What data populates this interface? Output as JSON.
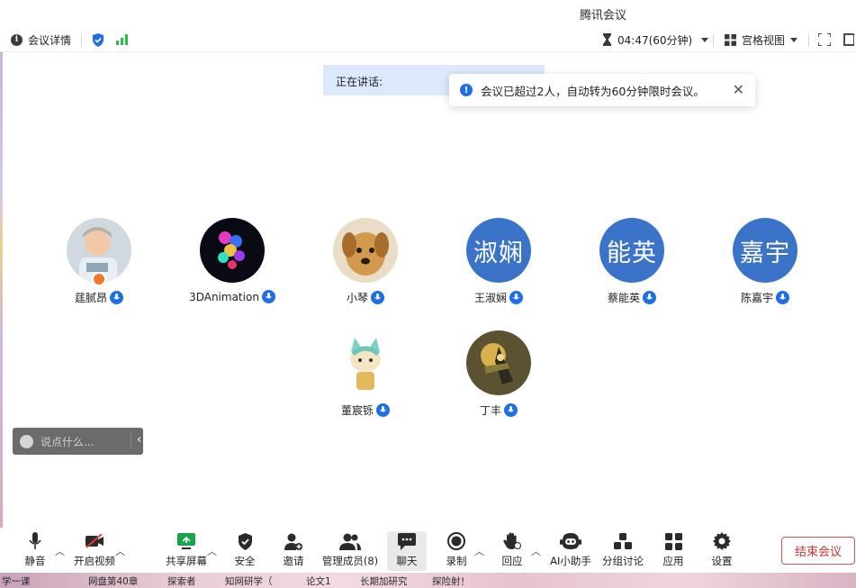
{
  "window": {
    "title": "腾讯会议"
  },
  "topbar": {
    "meeting_details": "会议详情",
    "timer": "04:47(60分钟)",
    "view_mode": "宫格视图"
  },
  "speaking": {
    "label": "正在讲话:"
  },
  "toast": {
    "message": "会议已超过2人，自动转为60分钟限时会议。"
  },
  "participants": [
    {
      "name": "莛腻昂",
      "avatar": "photo-baby"
    },
    {
      "name": "3DAnimation",
      "avatar": "photo-balloons"
    },
    {
      "name": "小琴",
      "avatar": "photo-dog"
    },
    {
      "name": "王淑娴",
      "avatar_text": "淑娴"
    },
    {
      "name": "蔡能英",
      "avatar_text": "能英"
    },
    {
      "name": "陈嘉宇",
      "avatar_text": "嘉宇"
    },
    {
      "name": "董宸铄",
      "avatar": "cartoon-cat"
    },
    {
      "name": "丁丰",
      "avatar": "photo-robot"
    }
  ],
  "chat": {
    "placeholder": "说点什么..."
  },
  "toolbar": {
    "mute": "静音",
    "video": "开启视频",
    "share": "共享屏幕",
    "security": "安全",
    "invite": "邀请",
    "members": "管理成员(8)",
    "chat": "聊天",
    "record": "录制",
    "react": "回应",
    "ai": "AI小助手",
    "breakout": "分组讨论",
    "apps": "应用",
    "settings": "设置",
    "end": "结束会议"
  },
  "taskbar": {
    "items": [
      "学一课",
      "网盘第40章",
      "探索者",
      "知网研学（",
      "论文1",
      "长期加研究",
      "探险射！"
    ]
  },
  "colors": {
    "accent": "#1e6ee8",
    "avatar_bg": "#3b73c8",
    "end_red": "#d0302b",
    "speaking_bg": "#dce8fb"
  }
}
